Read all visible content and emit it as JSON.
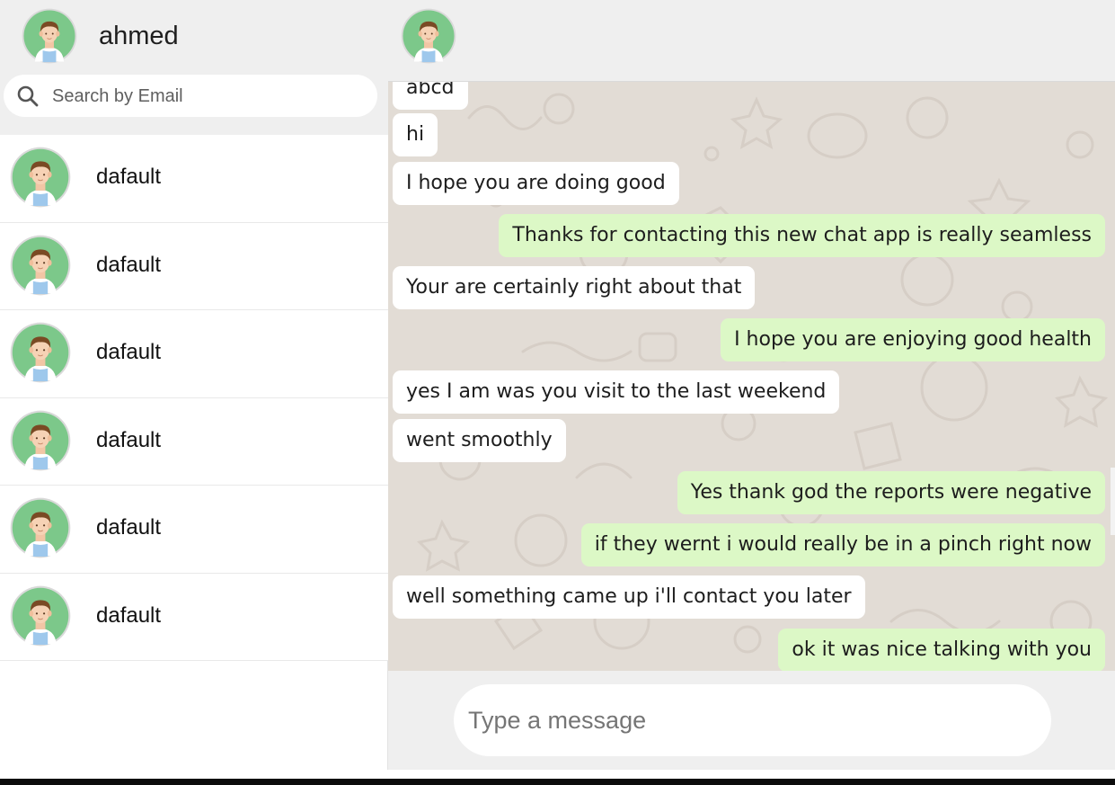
{
  "sidebar": {
    "profile": {
      "name": "ahmed",
      "avatar": "avatar-icon"
    },
    "search": {
      "placeholder": "Search by Email",
      "icon": "search-icon"
    },
    "contacts": [
      {
        "name": "dafault",
        "avatar": "avatar-icon"
      },
      {
        "name": "dafault",
        "avatar": "avatar-icon"
      },
      {
        "name": "dafault",
        "avatar": "avatar-icon"
      },
      {
        "name": "dafault",
        "avatar": "avatar-icon"
      },
      {
        "name": "dafault",
        "avatar": "avatar-icon"
      },
      {
        "name": "dafault",
        "avatar": "avatar-icon"
      }
    ]
  },
  "chat": {
    "header": {
      "avatar": "avatar-icon"
    },
    "messages": [
      {
        "text": "abcd",
        "direction": "in"
      },
      {
        "text": "hi",
        "direction": "in"
      },
      {
        "text": "I hope you are doing good",
        "direction": "in"
      },
      {
        "text": "Thanks for contacting this new chat app is really seamless",
        "direction": "out"
      },
      {
        "text": "Your are certainly right about that",
        "direction": "in"
      },
      {
        "text": "I hope you are enjoying good health",
        "direction": "out"
      },
      {
        "text": "yes I am was you visit to the last weekend",
        "direction": "in"
      },
      {
        "text": "went smoothly",
        "direction": "in"
      },
      {
        "text": "Yes thank god the reports were negative",
        "direction": "out"
      },
      {
        "text": "if they wernt i would really be in a pinch right now",
        "direction": "out"
      },
      {
        "text": "well something came up i'll contact you later",
        "direction": "in"
      },
      {
        "text": "ok it was nice talking with you",
        "direction": "out"
      }
    ],
    "composer": {
      "placeholder": "Type a message"
    }
  },
  "colors": {
    "panel_bg": "#efefef",
    "chat_wallpaper": "#e2dcd5",
    "incoming_bubble": "#ffffff",
    "outgoing_bubble": "#dcf8c6",
    "avatar_circle": "#7cc88a"
  }
}
